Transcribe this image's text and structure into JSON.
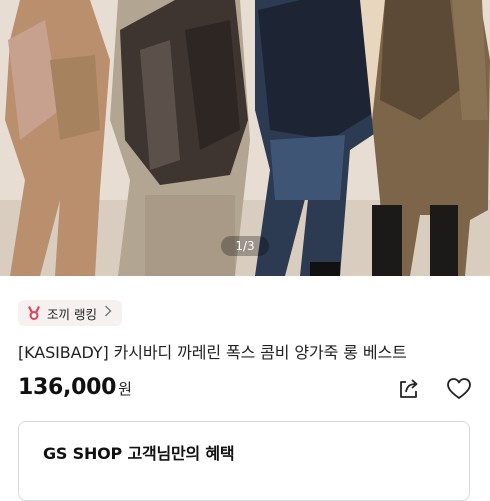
{
  "hero": {
    "image_alt": "Four models wearing fox fur combination leather long vests",
    "slide_counter": "1/3"
  },
  "ranking_badge": {
    "label": "조끼 랭킹",
    "icon": "medal-icon",
    "chevron": "chevron-right-icon"
  },
  "product": {
    "title": "[KASIBADY] 카시바디 까레린 폭스 콤비 양가죽 롱 베스트",
    "price": "136,000",
    "currency": "원"
  },
  "actions": {
    "share_icon": "share-icon",
    "wishlist_icon": "heart-icon"
  },
  "benefit": {
    "title": "GS SHOP 고객님만의 혜택"
  },
  "colors": {
    "badge_bg": "#f6f0f1",
    "medal": "#e0455f",
    "border": "#d9d9d9"
  }
}
